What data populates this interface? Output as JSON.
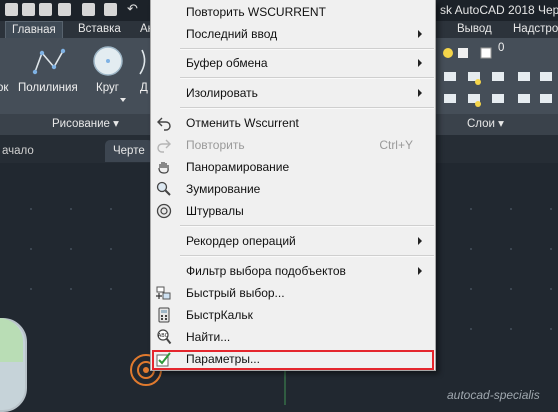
{
  "app": {
    "title_fragment": "sk AutoCAD 2018",
    "title_trailing": "Черт"
  },
  "ribbon": {
    "tabs_left": [
      "Главная",
      "Вставка",
      "Ан"
    ],
    "tabs_right": [
      "Вывод",
      "Надстро"
    ],
    "tool_left_partial": "ок",
    "tool_polyline": "Полилиния",
    "tool_circle": "Круг",
    "tool_arc_partial": "Д",
    "panel_draw": "Рисование ▾",
    "panel_layers": "Слои ▾",
    "layer_value": "0"
  },
  "file_tabs": [
    "ачало",
    "Черте"
  ],
  "watermark": "autocad-specialis",
  "colors": {
    "highlight": "#e4262d",
    "menu_bg": "#f0f0f0",
    "cursor": "#e07a2e"
  },
  "menu": {
    "repeat": "Повторить WSCURRENT",
    "recent_input": "Последний ввод",
    "clipboard": "Буфер обмена",
    "isolate": "Изолировать",
    "undo": "Отменить Wscurrent",
    "redo": "Повторить",
    "redo_accel": "Ctrl+Y",
    "pan": "Панорамирование",
    "zoom": "Зумирование",
    "steering": "Штурвалы",
    "action_recorder": "Рекордер операций",
    "subobject_filter": "Фильтр выбора подобъектов",
    "quick_select": "Быстрый выбор...",
    "quickcalc": "БыстрКальк",
    "find": "Найти...",
    "options": "Параметры...",
    "icons": {
      "undo": "undo-arrow-icon",
      "redo": "redo-arrow-icon",
      "pan": "pan-hand-icon",
      "zoom": "zoom-magnifier-icon",
      "steering": "steering-wheel-icon",
      "quick_select": "quick-select-icon",
      "quickcalc": "calculator-icon",
      "find": "find-abc-icon",
      "options": "checkmark-icon"
    }
  }
}
